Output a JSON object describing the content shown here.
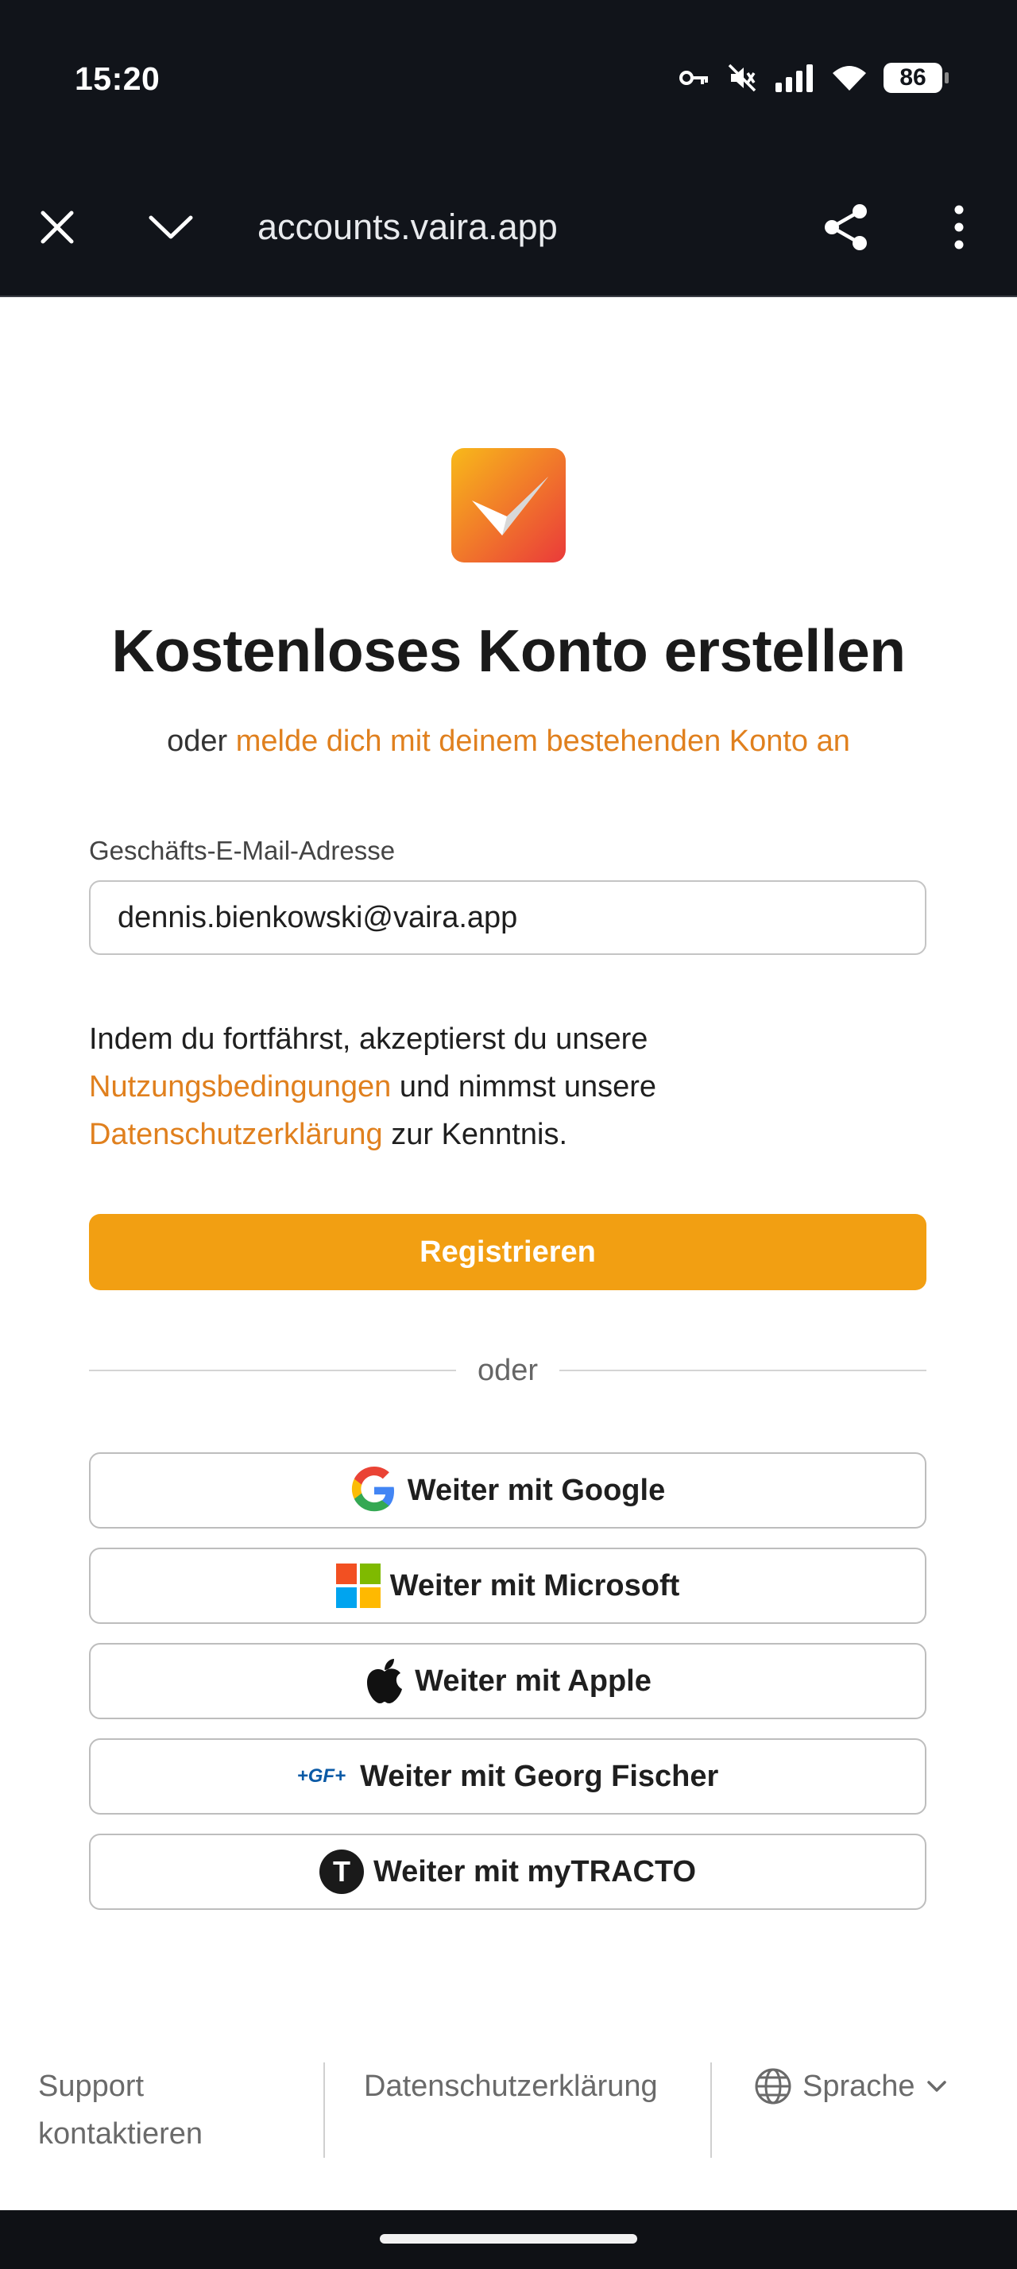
{
  "status_bar": {
    "time": "15:20",
    "battery": "86",
    "icons": [
      "key-icon",
      "mute-icon",
      "signal-icon",
      "wifi-icon",
      "battery-icon"
    ]
  },
  "browser": {
    "url": "accounts.vaira.app",
    "icons": [
      "close-icon",
      "chevron-down-icon",
      "share-icon",
      "more-vert-icon"
    ]
  },
  "page": {
    "title": "Kostenloses Konto erstellen",
    "subtitle_prefix": "oder ",
    "signin_link": "melde dich mit deinem bestehenden Konto an",
    "email_label": "Geschäfts-E-Mail-Adresse",
    "email_value": "dennis.bienkowski@vaira.app",
    "terms_part1": "Indem du fortfährst, akzeptierst du unsere",
    "terms_link1": "Nutzungsbedingungen",
    "terms_part2": " und nimmst unsere",
    "terms_link2": "Datenschutzerklärung",
    "terms_part3": " zur Kenntnis.",
    "register_button": "Registrieren",
    "divider_text": "oder",
    "sso": [
      {
        "label": "Weiter mit Google",
        "icon": "google-icon"
      },
      {
        "label": "Weiter mit Microsoft",
        "icon": "microsoft-icon"
      },
      {
        "label": "Weiter mit Apple",
        "icon": "apple-icon"
      },
      {
        "label": "Weiter mit Georg Fischer",
        "icon": "georg-fischer-icon",
        "icon_text": "+GF+"
      },
      {
        "label": "Weiter mit myTRACTO",
        "icon": "mytracto-icon",
        "icon_text": "T"
      }
    ]
  },
  "footer": {
    "support_line1": "Support",
    "support_line2": "kontaktieren",
    "privacy": "Datenschutzerklärung",
    "language": "Sprache"
  },
  "colors": {
    "accent_orange": "#f29f12",
    "link_orange": "#e0801e",
    "chrome_dark": "#11141a"
  }
}
